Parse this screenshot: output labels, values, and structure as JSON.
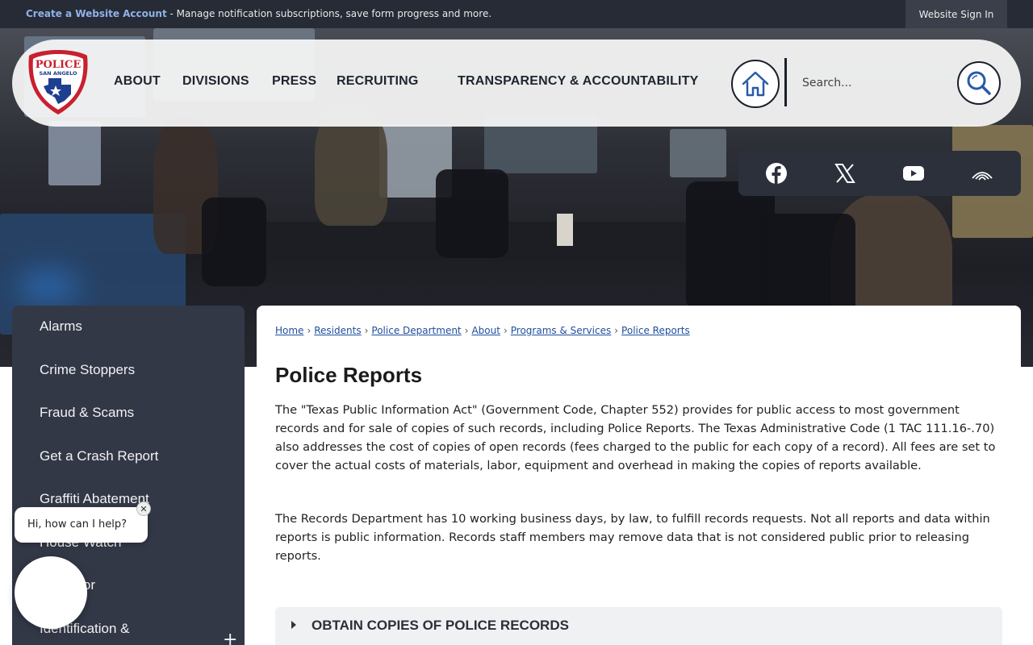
{
  "topbar": {
    "account_link": "Create a Website Account",
    "message": " - Manage notification subscriptions, save form progress and more.",
    "signin": "Website Sign In"
  },
  "header": {
    "logo_text_top": "POLICE",
    "logo_text_bottom": "SAN ANGELO",
    "nav": [
      "ABOUT",
      "DIVISIONS",
      "PRESS",
      "RECRUITING",
      "TRANSPARENCY & ACCOUNTABILITY"
    ],
    "search_placeholder": "Search..."
  },
  "social": {
    "icons": [
      "facebook-icon",
      "x-twitter-icon",
      "youtube-icon",
      "nextdoor-icon"
    ]
  },
  "sidebar": {
    "items": [
      "Alarms",
      "Crime Stoppers",
      "Fraud & Scams",
      "Get a Crash Report",
      "Graffiti Abatement",
      "House Watch",
      "Neighbor",
      "Identification &"
    ],
    "expand_symbol": "+"
  },
  "content": {
    "breadcrumb": [
      "Home",
      "Residents",
      "Police Department",
      "About",
      "Programs & Services",
      "Police Reports"
    ],
    "breadcrumb_sep": "›",
    "title": "Police Reports",
    "paragraphs": [
      "The \"Texas Public Information Act\" (Government Code, Chapter 552) provides for public access to most government records and for sale of copies of such records, including Police Reports. The Texas Administrative Code (1 TAC 111.16-.70) also addresses the cost of copies of open records (fees charged to the public for each copy of a record). All fees are set to cover the actual costs of materials, labor, equipment and overhead in making the copies of reports available.",
      "The Records Department has 10 working business days, by law, to fulfill records requests. Not all reports and data within reports is public information. Records staff members may remove data that is not considered public prior to releasing reports."
    ],
    "accordion_label": "OBTAIN COPIES OF POLICE RECORDS"
  },
  "chat": {
    "greeting": "Hi, how can I help?",
    "close": "✕"
  },
  "colors": {
    "topbar": "#262b36",
    "sidebar": "#333847",
    "social_bar": "#2b303b",
    "link": "#1f4e9b",
    "logo_red": "#c8202f",
    "logo_blue": "#1d3f8f"
  }
}
